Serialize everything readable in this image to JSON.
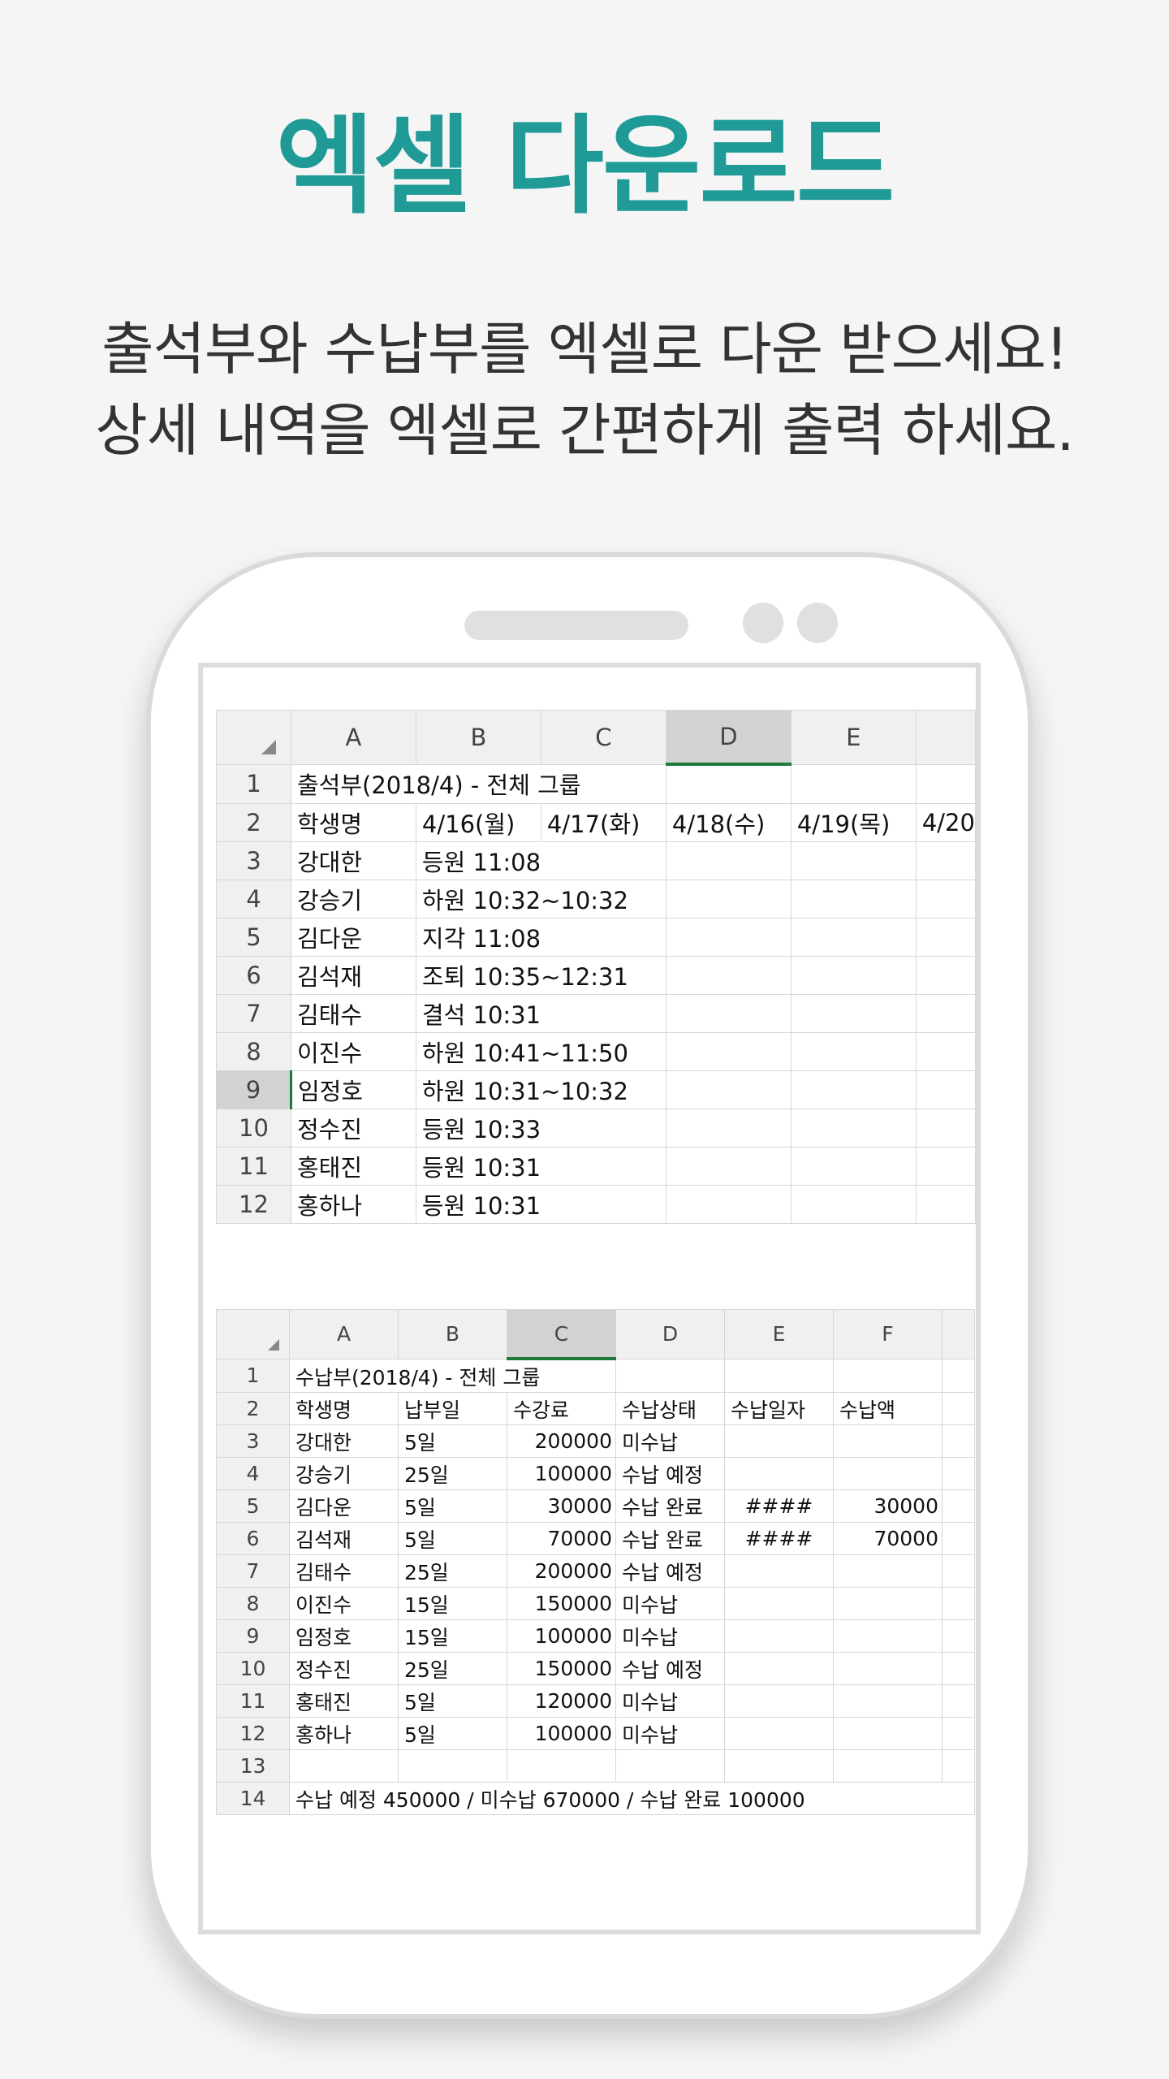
{
  "header": {
    "title": "엑셀 다운로드",
    "subtitle_line1": "출석부와 수납부를 엑셀로 다운 받으세요!",
    "subtitle_line2": "상세 내역을 엑셀로 간편하게 출력 하세요."
  },
  "attendance_sheet": {
    "columns": [
      "A",
      "B",
      "C",
      "D",
      "E"
    ],
    "selected_column": "D",
    "selected_row": "9",
    "title": "출석부(2018/4) - 전체 그룹",
    "header_row": [
      "학생명",
      "4/16(월)",
      "4/17(화)",
      "4/18(수)",
      "4/19(목)",
      "4/20"
    ],
    "rows": [
      {
        "num": "3",
        "name": "강대한",
        "record": "등원 11:08"
      },
      {
        "num": "4",
        "name": "강승기",
        "record": "하원 10:32~10:32"
      },
      {
        "num": "5",
        "name": "김다운",
        "record": "지각 11:08"
      },
      {
        "num": "6",
        "name": "김석재",
        "record": "조퇴 10:35~12:31"
      },
      {
        "num": "7",
        "name": "김태수",
        "record": "결석 10:31"
      },
      {
        "num": "8",
        "name": "이진수",
        "record": "하원 10:41~11:50"
      },
      {
        "num": "9",
        "name": "임정호",
        "record": "하원 10:31~10:32"
      },
      {
        "num": "10",
        "name": "정수진",
        "record": "등원 10:33"
      },
      {
        "num": "11",
        "name": "홍태진",
        "record": "등원 10:31"
      },
      {
        "num": "12",
        "name": "홍하나",
        "record": "등원 10:31"
      }
    ]
  },
  "payment_sheet": {
    "columns": [
      "A",
      "B",
      "C",
      "D",
      "E",
      "F"
    ],
    "selected_column": "C",
    "title": "수납부(2018/4) - 전체 그룹",
    "header_row": [
      "학생명",
      "납부일",
      "수강료",
      "수납상태",
      "수납일자",
      "수납액"
    ],
    "rows": [
      {
        "num": "3",
        "name": "강대한",
        "due": "5일",
        "fee": "200000",
        "status": "미수납",
        "date": "",
        "amount": ""
      },
      {
        "num": "4",
        "name": "강승기",
        "due": "25일",
        "fee": "100000",
        "status": "수납 예정",
        "date": "",
        "amount": ""
      },
      {
        "num": "5",
        "name": "김다운",
        "due": "5일",
        "fee": "30000",
        "status": "수납 완료",
        "date": "####",
        "amount": "30000"
      },
      {
        "num": "6",
        "name": "김석재",
        "due": "5일",
        "fee": "70000",
        "status": "수납 완료",
        "date": "####",
        "amount": "70000"
      },
      {
        "num": "7",
        "name": "김태수",
        "due": "25일",
        "fee": "200000",
        "status": "수납 예정",
        "date": "",
        "amount": ""
      },
      {
        "num": "8",
        "name": "이진수",
        "due": "15일",
        "fee": "150000",
        "status": "미수납",
        "date": "",
        "amount": ""
      },
      {
        "num": "9",
        "name": "임정호",
        "due": "15일",
        "fee": "100000",
        "status": "미수납",
        "date": "",
        "amount": ""
      },
      {
        "num": "10",
        "name": "정수진",
        "due": "25일",
        "fee": "150000",
        "status": "수납 예정",
        "date": "",
        "amount": ""
      },
      {
        "num": "11",
        "name": "홍태진",
        "due": "5일",
        "fee": "120000",
        "status": "미수납",
        "date": "",
        "amount": ""
      },
      {
        "num": "12",
        "name": "홍하나",
        "due": "5일",
        "fee": "100000",
        "status": "미수납",
        "date": "",
        "amount": ""
      }
    ],
    "summary_row_num": "14",
    "summary": "수납 예정 450000 / 미수납 670000 / 수납 완료 100000"
  }
}
